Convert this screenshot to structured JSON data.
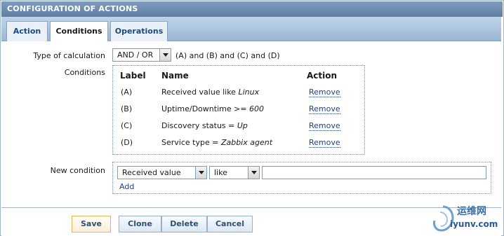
{
  "header": {
    "title": "CONFIGURATION OF ACTIONS"
  },
  "tabs": [
    {
      "label": "Action",
      "active": false
    },
    {
      "label": "Conditions",
      "active": true
    },
    {
      "label": "Operations",
      "active": false
    }
  ],
  "calculation": {
    "label": "Type of calculation",
    "selected": "AND / OR",
    "formula": "(A) and (B) and (C) and (D)"
  },
  "conditions": {
    "label": "Conditions",
    "columns": {
      "label": "Label",
      "name": "Name",
      "action": "Action"
    },
    "rows": [
      {
        "label": "(A)",
        "name_prefix": "Received value like ",
        "name_value": "Linux",
        "action": "Remove"
      },
      {
        "label": "(B)",
        "name_prefix": "Uptime/Downtime >= ",
        "name_value": "600",
        "action": "Remove"
      },
      {
        "label": "(C)",
        "name_prefix": "Discovery status = ",
        "name_value": "Up",
        "action": "Remove"
      },
      {
        "label": "(D)",
        "name_prefix": "Service type = ",
        "name_value": "Zabbix agent",
        "action": "Remove"
      }
    ]
  },
  "new_condition": {
    "label": "New condition",
    "type_selected": "Received value",
    "operator_selected": "like",
    "value": "",
    "add_label": "Add"
  },
  "footer": {
    "save": "Save",
    "clone": "Clone",
    "delete": "Delete",
    "cancel": "Cancel"
  },
  "watermark": {
    "cn": "运维网",
    "en": "iyunv.com"
  },
  "colors": {
    "header": "#6a89ac",
    "tabstrip": "#aec6e0",
    "link": "#1e3f8a",
    "save_border": "#f0b35a"
  }
}
